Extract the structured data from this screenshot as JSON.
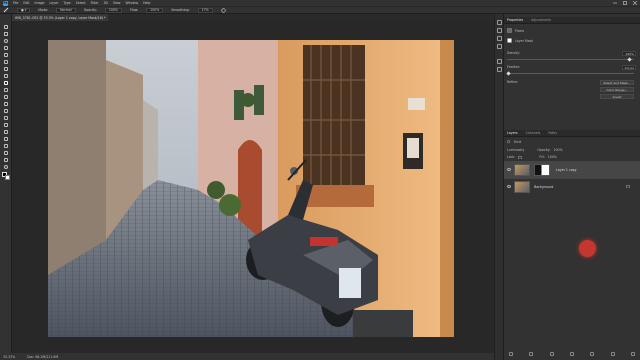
{
  "menubar": {
    "app": "Ps",
    "items": [
      "File",
      "Edit",
      "Image",
      "Layer",
      "Type",
      "Select",
      "Filter",
      "3D",
      "View",
      "Window",
      "Help"
    ]
  },
  "options": {
    "mode_label": "Mode:",
    "mode_value": "Normal",
    "opacity_label": "Opacity:",
    "opacity_value": "100%",
    "flow_label": "Flow:",
    "flow_value": "100%",
    "smoothing_label": "Smoothing:",
    "smoothing_value": "17%"
  },
  "document": {
    "tab_title": "IMG_5781.CR2 @ 33.3% (Layer 1 copy, Layer Mask/16) *",
    "zoom": "33.33%",
    "doc_info": "Doc: 68.2M/211.6M"
  },
  "properties": {
    "tabs": [
      "Properties",
      "Adjustments"
    ],
    "pixel_label": "Pixels",
    "layer_mask_label": "Layer Mask",
    "density_label": "Density:",
    "density_value": "100%",
    "feather_label": "Feather:",
    "feather_value": "0.0 px",
    "refine_label": "Refine:",
    "buttons": [
      "Select and Mask...",
      "Color Range...",
      "Invert"
    ]
  },
  "layers": {
    "tabs": [
      "Layers",
      "Channels",
      "Paths"
    ],
    "kind_label": "Kind",
    "blend_mode": "Luminosity",
    "opacity_label": "Opacity:",
    "opacity_value": "100%",
    "lock_label": "Lock:",
    "fill_label": "Fill:",
    "fill_value": "100%",
    "items": [
      {
        "name": "Layer 1 copy"
      },
      {
        "name": "Background"
      }
    ]
  },
  "colors": {
    "accent": "#c3372f",
    "panel": "#323232",
    "canvas": "#282828"
  }
}
